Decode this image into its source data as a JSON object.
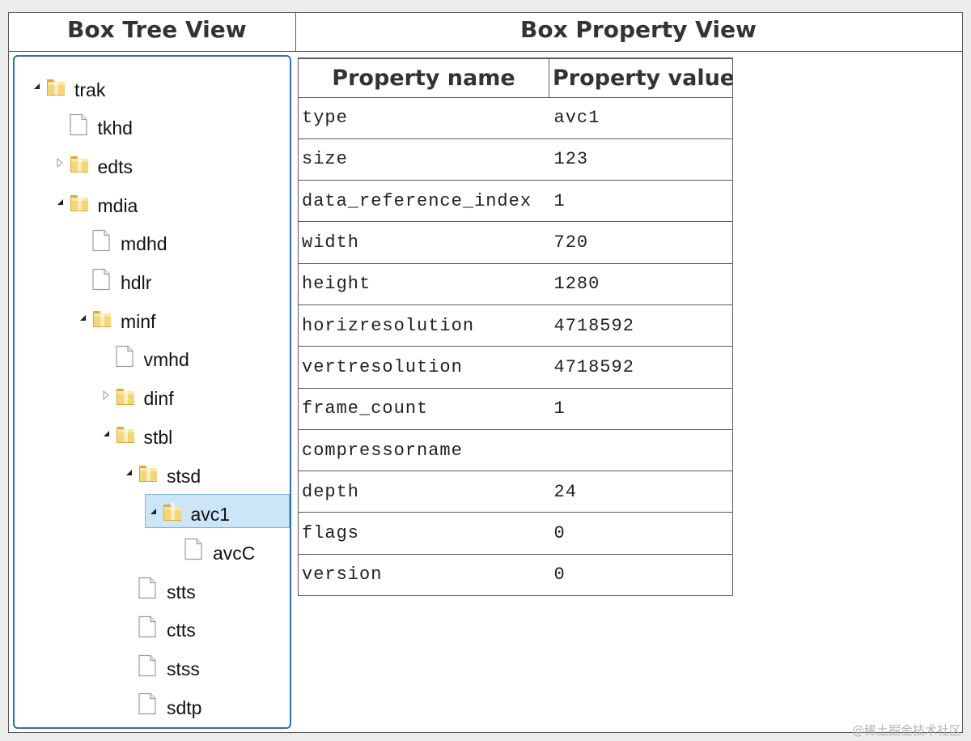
{
  "header": {
    "tree_title": "Box Tree View",
    "property_title": "Box Property View"
  },
  "tree": {
    "nodes": [
      {
        "label": "trak",
        "type": "folder",
        "state": "expanded",
        "depth": 0
      },
      {
        "label": "tkhd",
        "type": "file",
        "state": "leaf",
        "depth": 1
      },
      {
        "label": "edts",
        "type": "folder",
        "state": "collapsed",
        "depth": 1
      },
      {
        "label": "mdia",
        "type": "folder",
        "state": "expanded",
        "depth": 1
      },
      {
        "label": "mdhd",
        "type": "file",
        "state": "leaf",
        "depth": 2
      },
      {
        "label": "hdlr",
        "type": "file",
        "state": "leaf",
        "depth": 2
      },
      {
        "label": "minf",
        "type": "folder",
        "state": "expanded",
        "depth": 2
      },
      {
        "label": "vmhd",
        "type": "file",
        "state": "leaf",
        "depth": 3
      },
      {
        "label": "dinf",
        "type": "folder",
        "state": "collapsed",
        "depth": 3
      },
      {
        "label": "stbl",
        "type": "folder",
        "state": "expanded",
        "depth": 3
      },
      {
        "label": "stsd",
        "type": "folder",
        "state": "expanded",
        "depth": 4
      },
      {
        "label": "avc1",
        "type": "folder",
        "state": "expanded",
        "depth": 5,
        "selected": true
      },
      {
        "label": "avcC",
        "type": "file",
        "state": "leaf",
        "depth": 6
      },
      {
        "label": "stts",
        "type": "file",
        "state": "leaf",
        "depth": 4
      },
      {
        "label": "ctts",
        "type": "file",
        "state": "leaf",
        "depth": 4
      },
      {
        "label": "stss",
        "type": "file",
        "state": "leaf",
        "depth": 4
      },
      {
        "label": "sdtp",
        "type": "file",
        "state": "leaf",
        "depth": 4
      }
    ]
  },
  "properties": {
    "columns": [
      "Property name",
      "Property value"
    ],
    "rows": [
      {
        "name": "type",
        "value": "avc1"
      },
      {
        "name": "size",
        "value": "123"
      },
      {
        "name": "data_reference_index",
        "value": "1"
      },
      {
        "name": "width",
        "value": "720"
      },
      {
        "name": "height",
        "value": "1280"
      },
      {
        "name": "horizresolution",
        "value": "4718592"
      },
      {
        "name": "vertresolution",
        "value": "4718592"
      },
      {
        "name": "frame_count",
        "value": "1"
      },
      {
        "name": "compressorname",
        "value": ""
      },
      {
        "name": "depth",
        "value": "24"
      },
      {
        "name": "flags",
        "value": "0"
      },
      {
        "name": "version",
        "value": "0"
      }
    ]
  },
  "icons": {
    "expanded_toggle": "triangle-expanded-icon",
    "collapsed_toggle": "triangle-collapsed-icon",
    "folder": "folder-icon",
    "file": "file-icon"
  },
  "colors": {
    "selection_bg": "#cde6f7",
    "tree_border": "#2f6fb5",
    "folder_yellow": "#e8c35a"
  },
  "watermark": "@稀土掘金技术社区"
}
